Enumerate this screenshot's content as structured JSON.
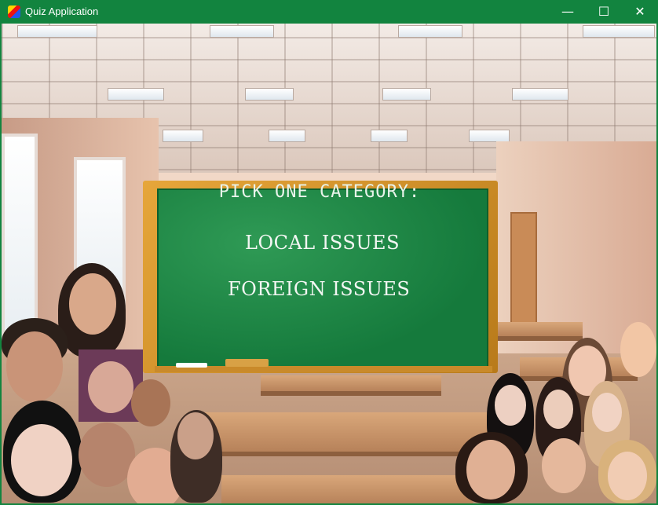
{
  "window": {
    "title": "Quiz Application",
    "controls": {
      "minimize": "—",
      "maximize": "☐",
      "close": "✕"
    }
  },
  "board": {
    "title": "PICK ONE CATEGORY:",
    "options": [
      {
        "label": "LOCAL ISSUES"
      },
      {
        "label": "FOREIGN ISSUES"
      }
    ]
  },
  "colors": {
    "titlebar": "#12843f",
    "chalkboard": "#1a7f40",
    "frame": "#d9962e"
  }
}
